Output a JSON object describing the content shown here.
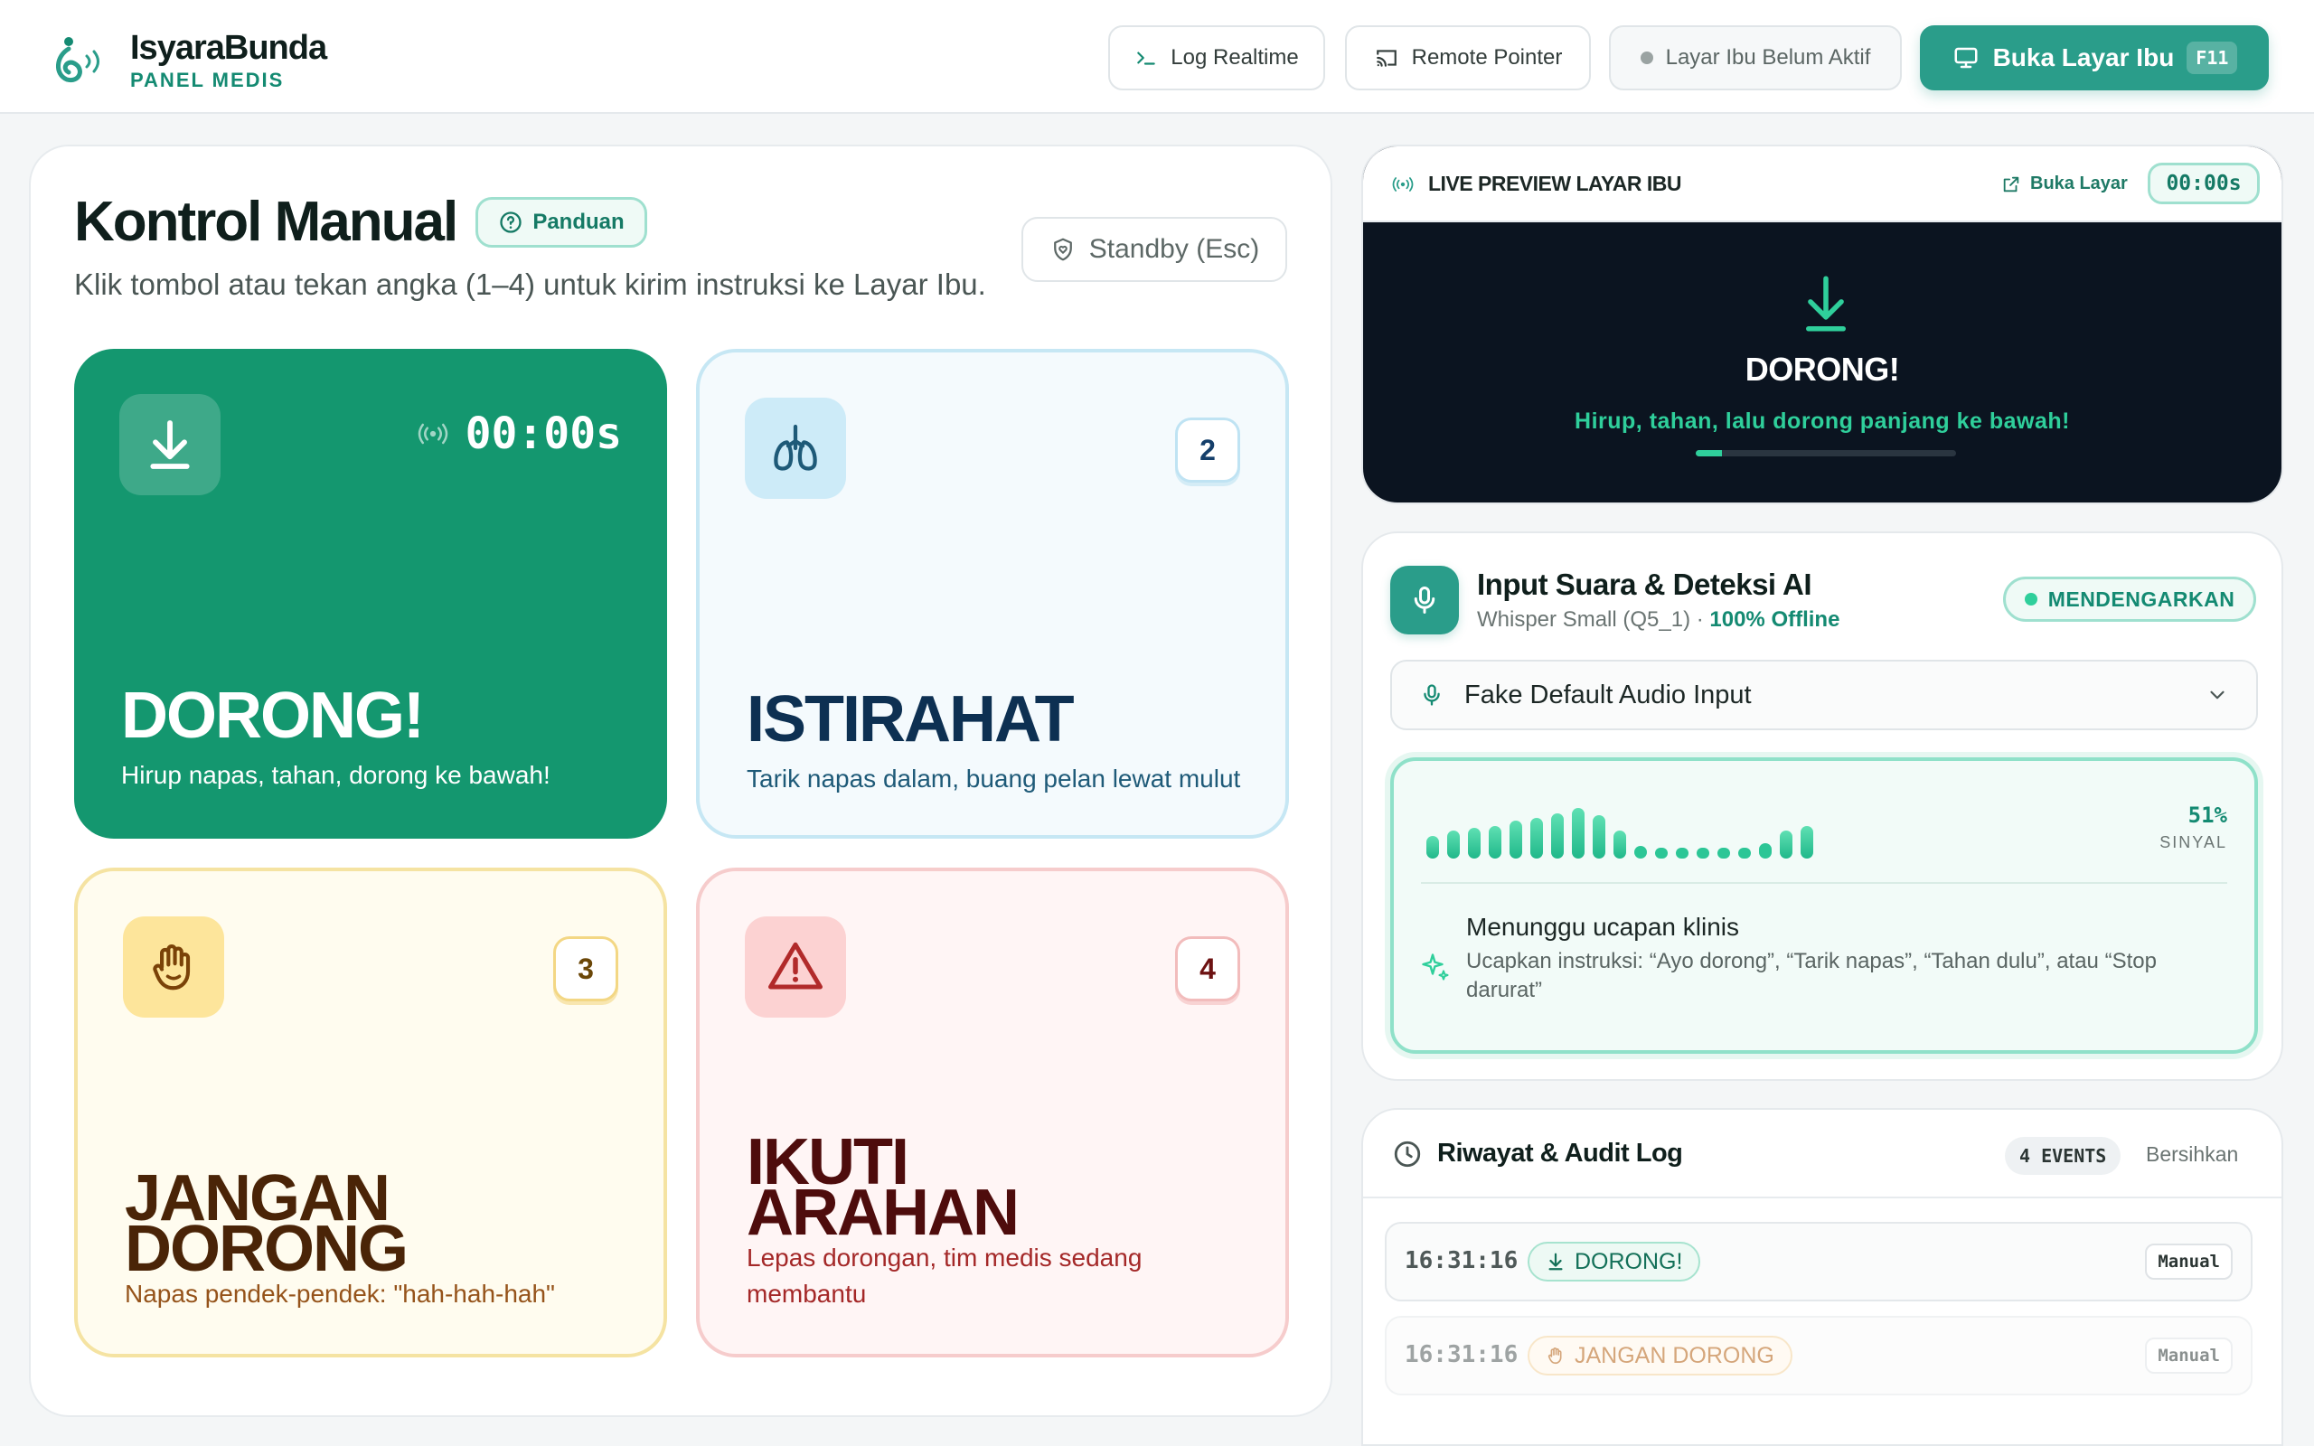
{
  "header": {
    "brand_name": "IsyaraBunda",
    "brand_sub": "PANEL MEDIS",
    "log_button": "Log Realtime",
    "remote_button": "Remote Pointer",
    "status_label": "Layar Ibu Belum Aktif",
    "open_button": "Buka Layar Ibu",
    "open_shortcut": "F11"
  },
  "control": {
    "title": "Kontrol Manual",
    "guide_label": "Panduan",
    "subtitle": "Klik tombol atau tekan angka (1–4) untuk kirim instruksi ke Layar Ibu.",
    "standby_label": "Standby (Esc)",
    "tiles": [
      {
        "title": "DORONG!",
        "desc": "Hirup napas, tahan, dorong ke bawah!",
        "timer": "00:00s",
        "icon": "arrow-down-icon",
        "color": "#14976f"
      },
      {
        "title": "ISTIRAHAT",
        "desc": "Tarik napas dalam, buang pelan lewat mulut",
        "key": "2",
        "icon": "lungs-icon",
        "color": "#f4fafd"
      },
      {
        "title_line1": "JANGAN",
        "title_line2": "DORONG",
        "desc": "Napas pendek-pendek: \"hah-hah-hah\"",
        "key": "3",
        "icon": "hand-icon",
        "color": "#fffcef"
      },
      {
        "title_line1": "IKUTI",
        "title_line2": "ARAHAN",
        "desc_line1": "Lepas dorongan, tim medis sedang",
        "desc_line2": "membantu",
        "key": "4",
        "icon": "warning-icon",
        "color": "#fff5f5"
      }
    ]
  },
  "preview": {
    "title": "LIVE PREVIEW LAYAR IBU",
    "open_label": "Buka Layar",
    "timer": "00:00s",
    "big_text": "DORONG!",
    "small_text": "Hirup, tahan, lalu dorong panjang ke bawah!",
    "progress": 0.1
  },
  "voice": {
    "title": "Input Suara & Deteksi AI",
    "model": "Whisper Small (Q5_1)",
    "model_sep": " · ",
    "offline": "100% Offline",
    "status": "MENDENGARKAN",
    "device": "Fake Default Audio Input",
    "signal_pct": "51%",
    "signal_label": "SINYAL",
    "levels": [
      0.45,
      0.55,
      0.6,
      0.65,
      0.75,
      0.8,
      0.9,
      1.0,
      0.85,
      0.55,
      0.25,
      0.2,
      0.2,
      0.2,
      0.2,
      0.2,
      0.3,
      0.55,
      0.65
    ],
    "wait_title": "Menunggu ucapan klinis",
    "wait_line1": "Ucapkan instruksi: “Ayo dorong”, “Tarik napas”, “Tahan dulu”, atau “Stop",
    "wait_line2": "darurat”"
  },
  "log": {
    "title": "Riwayat & Audit Log",
    "count": "4 EVENTS",
    "clear_label": "Bersihkan",
    "entries": [
      {
        "time": "16:31:16",
        "label": "DORONG!",
        "source": "Manual"
      },
      {
        "time": "16:31:16",
        "label": "JANGAN DORONG",
        "source": "Manual"
      }
    ]
  }
}
